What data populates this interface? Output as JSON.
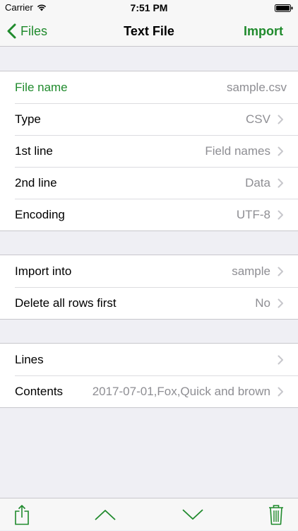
{
  "status": {
    "carrier": "Carrier",
    "time": "7:51 PM"
  },
  "nav": {
    "back_label": "Files",
    "title": "Text File",
    "action_label": "Import"
  },
  "file_section": {
    "rows": [
      {
        "label": "File name",
        "value": "sample.csv"
      },
      {
        "label": "Type",
        "value": "CSV"
      },
      {
        "label": "1st line",
        "value": "Field names"
      },
      {
        "label": "2nd line",
        "value": "Data"
      },
      {
        "label": "Encoding",
        "value": "UTF-8"
      }
    ]
  },
  "import_section": {
    "rows": [
      {
        "label": "Import into",
        "value": "sample"
      },
      {
        "label": "Delete all rows first",
        "value": "No"
      }
    ]
  },
  "content_section": {
    "rows": [
      {
        "label": "Lines",
        "value": ""
      },
      {
        "label": "Contents",
        "value": "2017-07-01,Fox,Quick and brown"
      }
    ]
  },
  "toolbar": {
    "icons": [
      "share-icon",
      "chevron-up-icon",
      "chevron-down-icon",
      "trash-icon"
    ]
  },
  "colors": {
    "accent": "#1f8a2c",
    "value_gray": "#8e8e93",
    "background": "#efeff4"
  }
}
